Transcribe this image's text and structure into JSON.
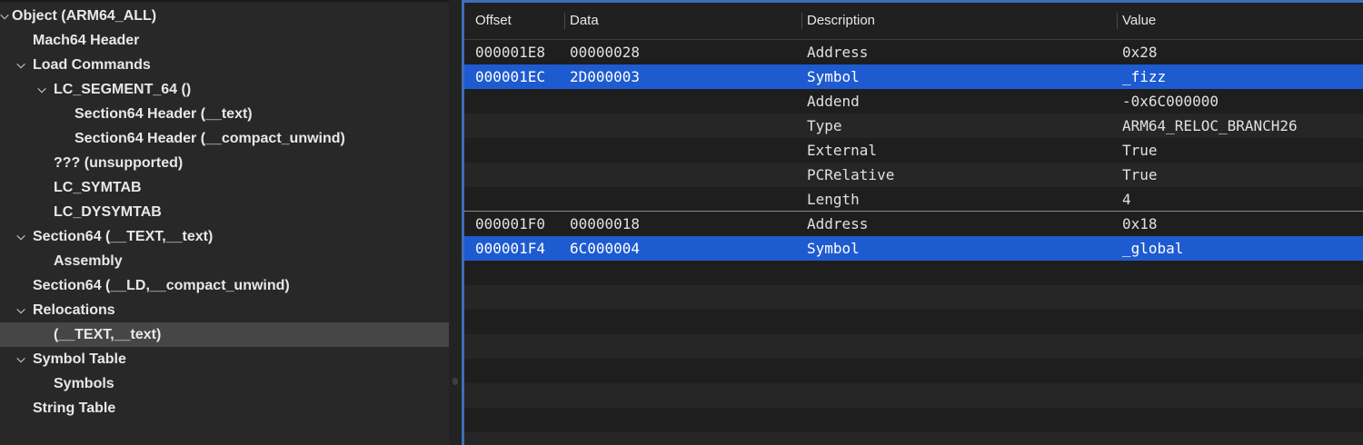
{
  "sidebar": {
    "tree": [
      {
        "label": "Object  (ARM64_ALL)",
        "chevron": "expanded"
      },
      {
        "label": "Mach64 Header",
        "chevron": ""
      },
      {
        "label": "Load Commands",
        "chevron": "expanded"
      },
      {
        "label": "LC_SEGMENT_64 ()",
        "chevron": "expanded"
      },
      {
        "label": "Section64 Header (__text)",
        "chevron": ""
      },
      {
        "label": "Section64 Header (__compact_unwind)",
        "chevron": ""
      },
      {
        "label": "??? (unsupported)",
        "chevron": ""
      },
      {
        "label": "LC_SYMTAB",
        "chevron": ""
      },
      {
        "label": "LC_DYSYMTAB",
        "chevron": ""
      },
      {
        "label": "Section64 (__TEXT,__text)",
        "chevron": "expanded"
      },
      {
        "label": "Assembly",
        "chevron": ""
      },
      {
        "label": "Section64 (__LD,__compact_unwind)",
        "chevron": ""
      },
      {
        "label": "Relocations",
        "chevron": "expanded"
      },
      {
        "label": "(__TEXT,__text)",
        "chevron": "",
        "selected": true
      },
      {
        "label": "Symbol Table",
        "chevron": "expanded"
      },
      {
        "label": "Symbols",
        "chevron": ""
      },
      {
        "label": "String Table",
        "chevron": ""
      }
    ]
  },
  "table": {
    "columns": [
      "Offset",
      "Data",
      "Description",
      "Value"
    ],
    "rows": [
      {
        "offset": "000001E8",
        "data": "00000028",
        "description": "Address",
        "value": "0x28"
      },
      {
        "offset": "000001EC",
        "data": "2D000003",
        "description": "Symbol",
        "value": "_fizz",
        "selected": true
      },
      {
        "offset": "",
        "data": "",
        "description": "Addend",
        "value": "-0x6C000000"
      },
      {
        "offset": "",
        "data": "",
        "description": "Type",
        "value": "ARM64_RELOC_BRANCH26"
      },
      {
        "offset": "",
        "data": "",
        "description": "External",
        "value": "True"
      },
      {
        "offset": "",
        "data": "",
        "description": "PCRelative",
        "value": "True"
      },
      {
        "offset": "",
        "data": "",
        "description": "Length",
        "value": "4"
      },
      {
        "offset": "000001F0",
        "data": "00000018",
        "description": "Address",
        "value": "0x18"
      },
      {
        "offset": "000001F4",
        "data": "6C000004",
        "description": "Symbol",
        "value": "_global",
        "selected": true
      }
    ]
  },
  "colors": {
    "selection": "#1e5bd0",
    "sidebar_selection": "#464646",
    "focus_ring": "#3e6eb8"
  }
}
